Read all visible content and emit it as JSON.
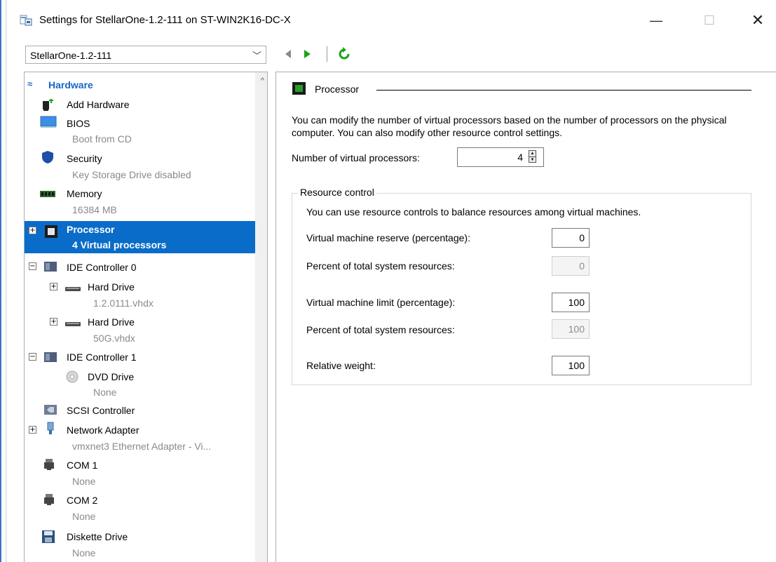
{
  "window": {
    "title": "Settings for StellarOne-1.2-111 on ST-WIN2K16-DC-X",
    "minimize": "—",
    "maximize": "☐",
    "close": "✕"
  },
  "toolbar": {
    "vm_selected": "StellarOne-1.2-111"
  },
  "tree": {
    "section": "Hardware",
    "items": [
      {
        "label": "Add Hardware",
        "sub": ""
      },
      {
        "label": "BIOS",
        "sub": "Boot from CD"
      },
      {
        "label": "Security",
        "sub": "Key Storage Drive disabled"
      },
      {
        "label": "Memory",
        "sub": "16384 MB"
      },
      {
        "label": "Processor",
        "sub": "4 Virtual processors"
      },
      {
        "label": "IDE Controller 0",
        "sub": ""
      },
      {
        "label": "Hard Drive",
        "sub": "1.2.0111.vhdx"
      },
      {
        "label": "Hard Drive",
        "sub": "50G.vhdx"
      },
      {
        "label": "IDE Controller 1",
        "sub": ""
      },
      {
        "label": "DVD Drive",
        "sub": "None"
      },
      {
        "label": "SCSI Controller",
        "sub": ""
      },
      {
        "label": "Network Adapter",
        "sub": "vmxnet3 Ethernet Adapter - Vi..."
      },
      {
        "label": "COM 1",
        "sub": "None"
      },
      {
        "label": "COM 2",
        "sub": "None"
      },
      {
        "label": "Diskette Drive",
        "sub": "None"
      }
    ]
  },
  "processor": {
    "heading": "Processor",
    "description": "You can modify the number of virtual processors based on the number of processors on the physical computer. You can also modify other resource control settings.",
    "vp_label": "Number of virtual processors:",
    "vp_value": "4",
    "resource_control": {
      "title": "Resource control",
      "description": "You can use resource controls to balance resources among virtual machines.",
      "reserve_label": "Virtual machine reserve (percentage):",
      "reserve_value": "0",
      "reserve_total_label": "Percent of total system resources:",
      "reserve_total_value": "0",
      "limit_label": "Virtual machine limit (percentage):",
      "limit_value": "100",
      "limit_total_label": "Percent of total system resources:",
      "limit_total_value": "100",
      "weight_label": "Relative weight:",
      "weight_value": "100"
    }
  }
}
